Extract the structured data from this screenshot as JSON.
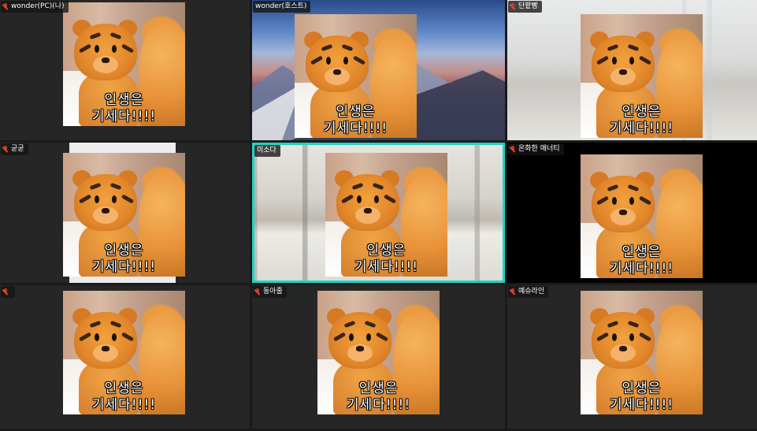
{
  "caption": {
    "line1": "인생은",
    "line2": "기세다!!!!"
  },
  "participants": [
    {
      "name": "wonder(PC)(나)",
      "muted": true
    },
    {
      "name": "wonder(호스트)",
      "muted": false
    },
    {
      "name": "단팥빵",
      "muted": true
    },
    {
      "name": "굳굳",
      "muted": true
    },
    {
      "name": "미소다",
      "muted": false,
      "active_speaker": true
    },
    {
      "name": "온화한 매너티",
      "muted": true
    },
    {
      "name": "",
      "muted": true
    },
    {
      "name": "동아줄",
      "muted": true
    },
    {
      "name": "예슈라인",
      "muted": true
    }
  ],
  "colors": {
    "active_border": "#22d3c4",
    "tile_bg": "#262626",
    "muted_icon": "#e8452f"
  }
}
